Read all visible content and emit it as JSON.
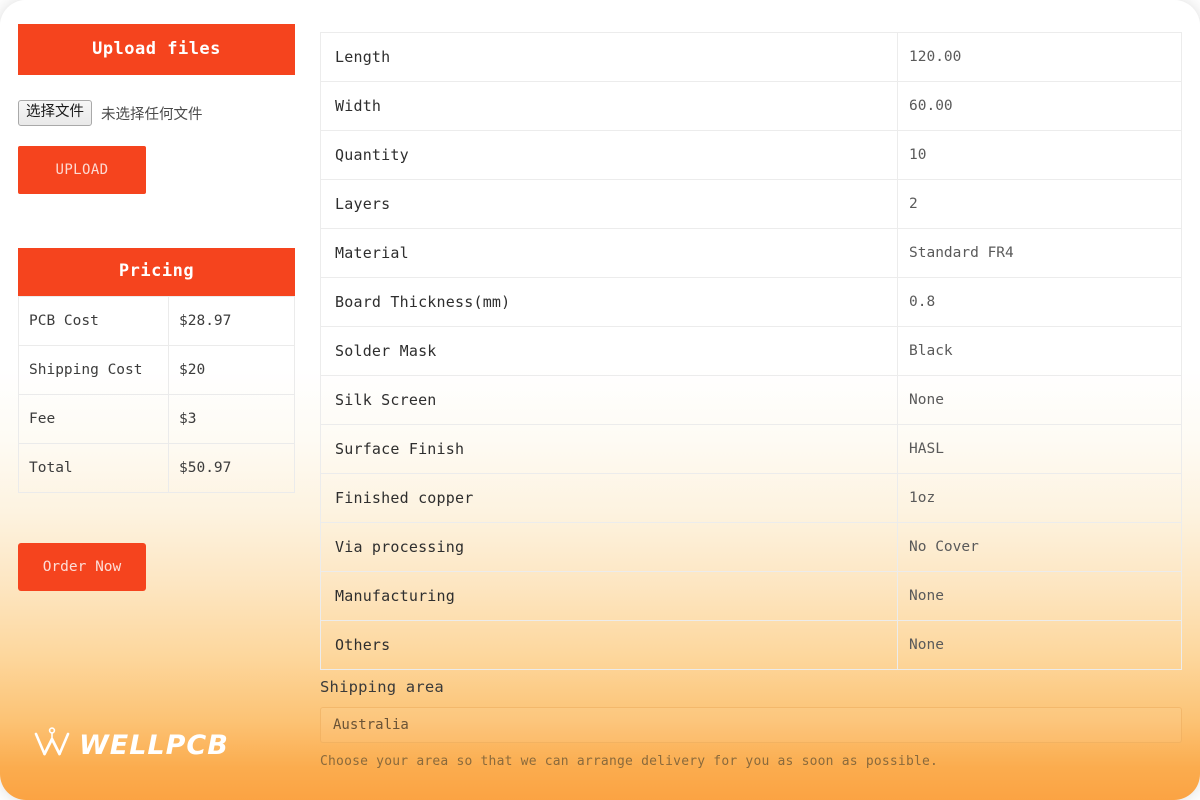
{
  "upload": {
    "header": "Upload files",
    "choose_file_button": "选择文件",
    "file_status": "未选择任何文件",
    "upload_button": "UPLOAD"
  },
  "pricing": {
    "header": "Pricing",
    "rows": [
      {
        "label": "PCB Cost",
        "value": "$28.97"
      },
      {
        "label": "Shipping Cost",
        "value": "$20"
      },
      {
        "label": "Fee",
        "value": "$3"
      },
      {
        "label": "Total",
        "value": "$50.97"
      }
    ],
    "order_button": "Order Now"
  },
  "logo": {
    "text": "WELLPCB"
  },
  "spec": {
    "rows": [
      {
        "label": "Length",
        "value": "120.00"
      },
      {
        "label": "Width",
        "value": "60.00"
      },
      {
        "label": "Quantity",
        "value": "10"
      },
      {
        "label": "Layers",
        "value": "2"
      },
      {
        "label": "Material",
        "value": "Standard FR4"
      },
      {
        "label": "Board Thickness(mm)",
        "value": "0.8"
      },
      {
        "label": "Solder Mask",
        "value": "Black"
      },
      {
        "label": "Silk Screen",
        "value": "None"
      },
      {
        "label": "Surface Finish",
        "value": "HASL"
      },
      {
        "label": "Finished copper",
        "value": "1oz"
      },
      {
        "label": "Via processing",
        "value": "No Cover"
      },
      {
        "label": "Manufacturing",
        "value": "None"
      },
      {
        "label": "Others",
        "value": "None"
      }
    ]
  },
  "shipping": {
    "label": "Shipping area",
    "selected": "Australia",
    "hint": "Choose your area so that we can arrange delivery for you as soon as possible."
  },
  "colors": {
    "accent": "#f5441e",
    "page_gradient_end": "#fba343"
  }
}
